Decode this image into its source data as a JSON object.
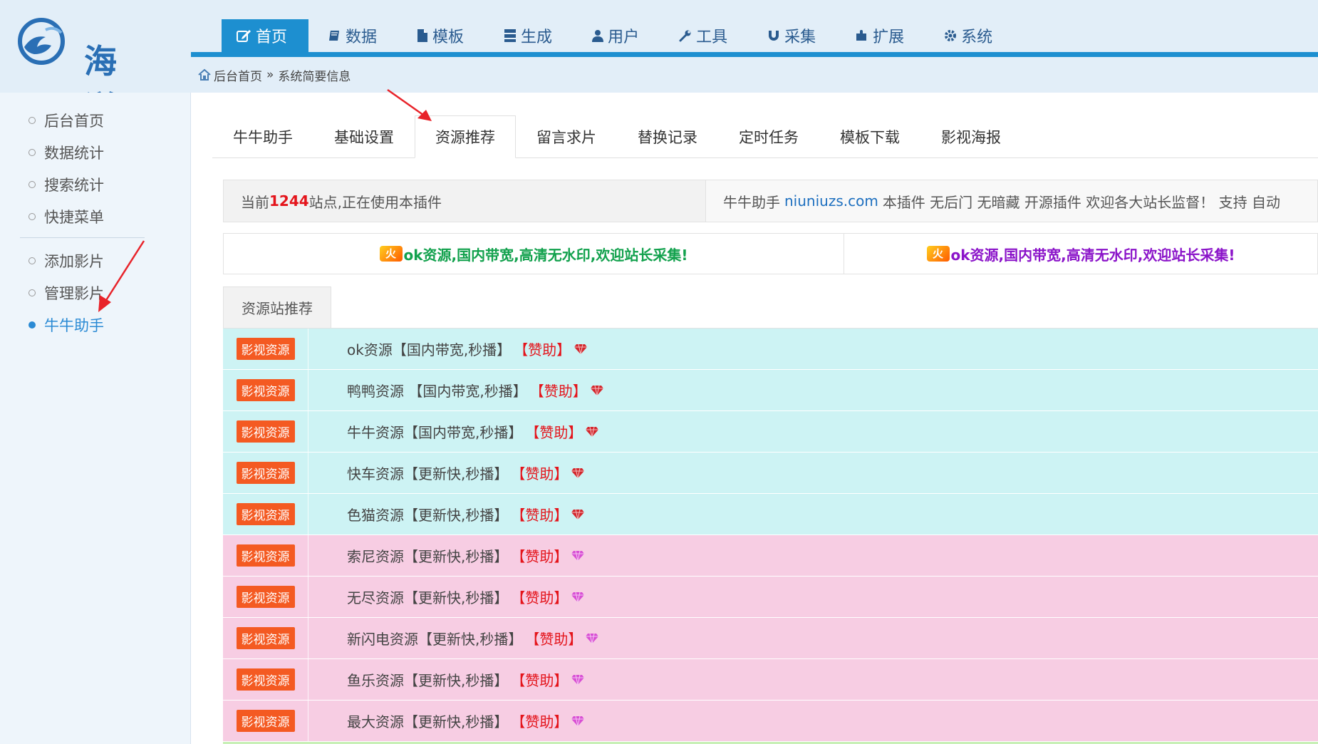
{
  "header": {
    "logo_text": "海洋",
    "nav": [
      {
        "label": "首页",
        "icon": "edit-icon",
        "active": true
      },
      {
        "label": "数据",
        "icon": "book-icon"
      },
      {
        "label": "模板",
        "icon": "file-icon"
      },
      {
        "label": "生成",
        "icon": "server-icon"
      },
      {
        "label": "用户",
        "icon": "user-icon"
      },
      {
        "label": "工具",
        "icon": "wrench-icon"
      },
      {
        "label": "采集",
        "icon": "magnet-icon"
      },
      {
        "label": "扩展",
        "icon": "puzzle-icon"
      },
      {
        "label": "系统",
        "icon": "gear-icon"
      }
    ],
    "breadcrumb": {
      "home": "后台首页",
      "separator": "»",
      "current": "系统简要信息"
    }
  },
  "sidebar": {
    "group1": [
      "后台首页",
      "数据统计",
      "搜索统计",
      "快捷菜单"
    ],
    "group2": [
      "添加影片",
      "管理影片",
      "牛牛助手"
    ],
    "active": "牛牛助手"
  },
  "tabs": [
    "牛牛助手",
    "基础设置",
    "资源推荐",
    "留言求片",
    "替换记录",
    "定时任务",
    "模板下载",
    "影视海报"
  ],
  "active_tab": "资源推荐",
  "info": {
    "prefix": "当前",
    "count": "1244",
    "suffix": "站点,正在使用本插件",
    "right_prefix": "牛牛助手",
    "site": "niuniuzs.com",
    "right_suffix": "本插件 无后门 无暗藏   开源插件   欢迎各大站长监督！ 支持 自动"
  },
  "ads": {
    "fire_label": "火",
    "ad1": "ok资源,国内带宽,高清无水印,欢迎站长采集!",
    "ad2": "ok资源,国内带宽,高清无水印,欢迎站长采集!"
  },
  "panel": {
    "title": "资源站推荐",
    "badge": "影视资源",
    "sponsor": "【赞助】",
    "rows": [
      {
        "name": "ok资源【国内带宽,秒播】",
        "color": "cyan"
      },
      {
        "name": "鸭鸭资源 【国内带宽,秒播】",
        "color": "cyan"
      },
      {
        "name": "牛牛资源【国内带宽,秒播】",
        "color": "cyan"
      },
      {
        "name": "快车资源【更新快,秒播】",
        "color": "cyan"
      },
      {
        "name": "色猫资源【更新快,秒播】",
        "color": "cyan"
      },
      {
        "name": "索尼资源【更新快,秒播】",
        "color": "pink"
      },
      {
        "name": "无尽资源【更新快,秒播】",
        "color": "pink"
      },
      {
        "name": "新闪电资源【更新快,秒播】",
        "color": "pink"
      },
      {
        "name": "鱼乐资源【更新快,秒播】",
        "color": "pink"
      },
      {
        "name": "最大资源【更新快,秒播】",
        "color": "pink"
      }
    ]
  },
  "colors": {
    "accent": "#1d8fd0",
    "gem_red": "#d3262c",
    "gem_pink": "#d94fd4",
    "annotation_red": "#e8232a"
  }
}
